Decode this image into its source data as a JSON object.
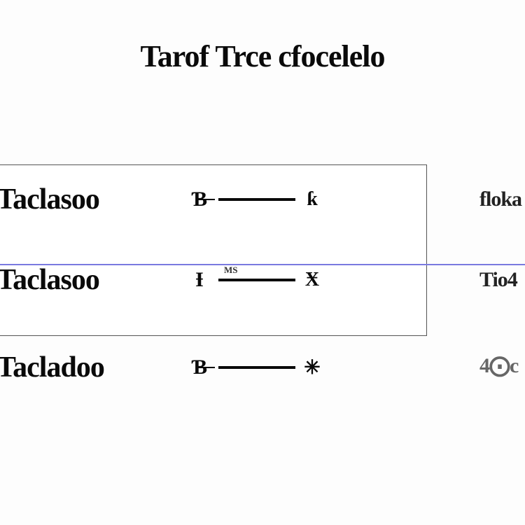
{
  "title": "Tarof Trce cfocelelo",
  "rows": [
    {
      "label": "Taclasoo",
      "startGlyph": "Ɓ",
      "connectorLabel": "",
      "endGlyph": "ƙ",
      "rightText": "floka"
    },
    {
      "label": "Taclasoo",
      "startGlyph": "Ɨ",
      "connectorLabel": "MS",
      "endGlyph": "Ӿ",
      "rightText": "Tio4"
    },
    {
      "label": "Tacladoo",
      "startGlyph": "Ɓ",
      "connectorLabel": "",
      "endGlyph": "✳",
      "rightText": "4⨀c"
    }
  ]
}
